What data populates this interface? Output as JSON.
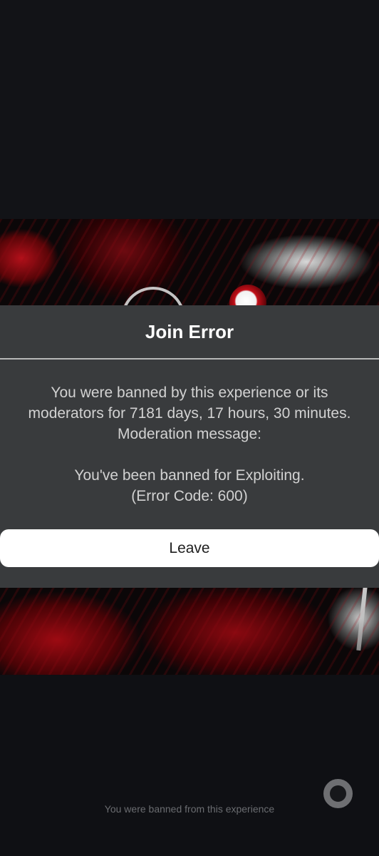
{
  "dialog": {
    "title": "Join Error",
    "message_lines": [
      "You were banned by this experience or its",
      "moderators for 7181 days, 17 hours, 30 minutes.",
      "Moderation message:",
      "You've been banned for Exploiting.",
      "(Error Code: 600)"
    ],
    "leave_label": "Leave"
  },
  "footer": {
    "status_text": "You were banned from this experience",
    "spinner_icon": "loading-spinner-icon"
  },
  "colors": {
    "dialog_background": "#393b3d",
    "screen_background": "#111216",
    "button_background": "#ffffff",
    "accent_red": "#b3101a"
  }
}
